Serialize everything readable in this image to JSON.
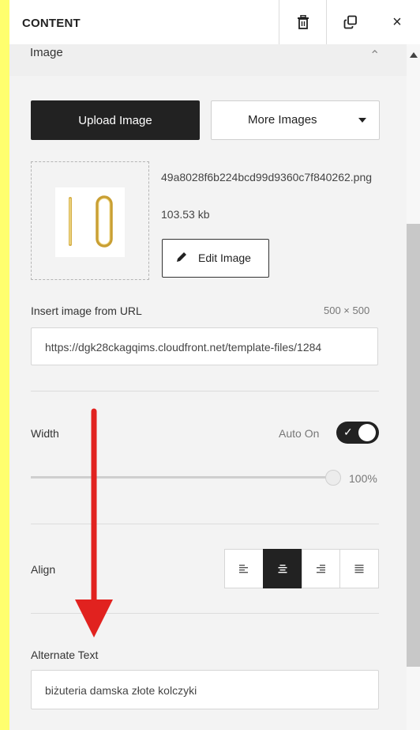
{
  "header": {
    "title": "CONTENT",
    "delete_icon": "trash-icon",
    "duplicate_icon": "duplicate-icon",
    "close_icon": "close-icon",
    "close_glyph": "×"
  },
  "section": {
    "label": "Image",
    "chevron": "⌃"
  },
  "upload": {
    "upload_label": "Upload Image",
    "more_label": "More Images"
  },
  "file": {
    "name": "49a8028f6b224bcd99d9360c7f840262.png",
    "size": "103.53 kb",
    "edit_label": "Edit Image"
  },
  "url": {
    "label": "Insert image from URL",
    "dimensions": "500 × 500",
    "value": "https://dgk28ckagqims.cloudfront.net/template-files/1284"
  },
  "width": {
    "label": "Width",
    "auto_label": "Auto On",
    "auto_on": true,
    "value_label": "100%",
    "value": 100
  },
  "align": {
    "label": "Align",
    "options": [
      "align-left",
      "align-center",
      "align-right",
      "align-justify"
    ],
    "selected": "align-center"
  },
  "alt": {
    "label": "Alternate Text",
    "value": "biżuteria damska złote kolczyki"
  },
  "colors": {
    "accent": "#222222",
    "annotation_arrow": "#e1221f",
    "page_bg": "#ffff6e"
  }
}
